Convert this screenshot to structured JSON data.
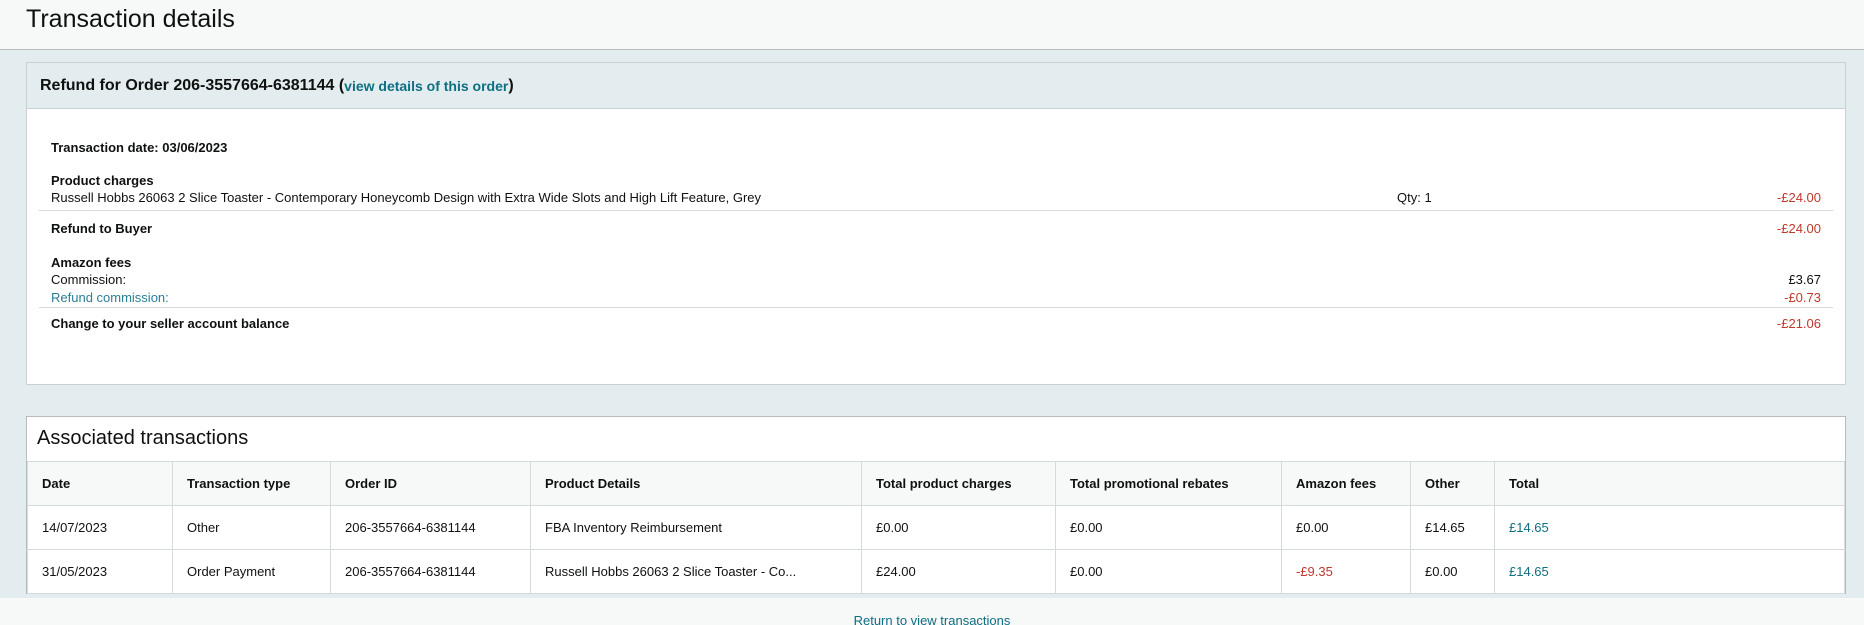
{
  "page": {
    "title": "Transaction details"
  },
  "refund": {
    "heading_prefix": "Refund for Order 206-3557664-6381144 (",
    "view_link": "view details of this order",
    "heading_suffix": ")",
    "transaction_date": "Transaction date: 03/06/2023",
    "product_charges": {
      "label": "Product charges",
      "item": "Russell Hobbs 26063 2 Slice Toaster - Contemporary Honeycomb Design with Extra Wide Slots and High Lift Feature, Grey",
      "qty": "Qty: 1",
      "amount": "-£24.00"
    },
    "refund_to_buyer": {
      "label": "Refund to Buyer",
      "amount": "-£24.00"
    },
    "amazon_fees": {
      "label": "Amazon fees",
      "commission_label": "Commission:",
      "commission_amount": "£3.67",
      "refund_commission_label": "Refund commission:",
      "refund_commission_amount": "-£0.73"
    },
    "balance_change": {
      "label": "Change to your seller account balance",
      "amount": "-£21.06"
    }
  },
  "associated": {
    "title": "Associated transactions",
    "columns": [
      "Date",
      "Transaction type",
      "Order ID",
      "Product Details",
      "Total product charges",
      "Total promotional rebates",
      "Amazon fees",
      "Other",
      "Total"
    ],
    "rows": [
      [
        "14/07/2023",
        "Other",
        "206-3557664-6381144",
        "FBA Inventory Reimbursement",
        "£0.00",
        "£0.00",
        "£0.00",
        "£14.65",
        "£14.65"
      ],
      [
        "31/05/2023",
        "Order Payment",
        "206-3557664-6381144",
        "Russell Hobbs 26063 2 Slice Toaster - Co...",
        "£24.00",
        "£0.00",
        "-£9.35",
        "£0.00",
        "£14.65"
      ]
    ]
  },
  "footer": {
    "return_link": "Return to view transactions"
  }
}
